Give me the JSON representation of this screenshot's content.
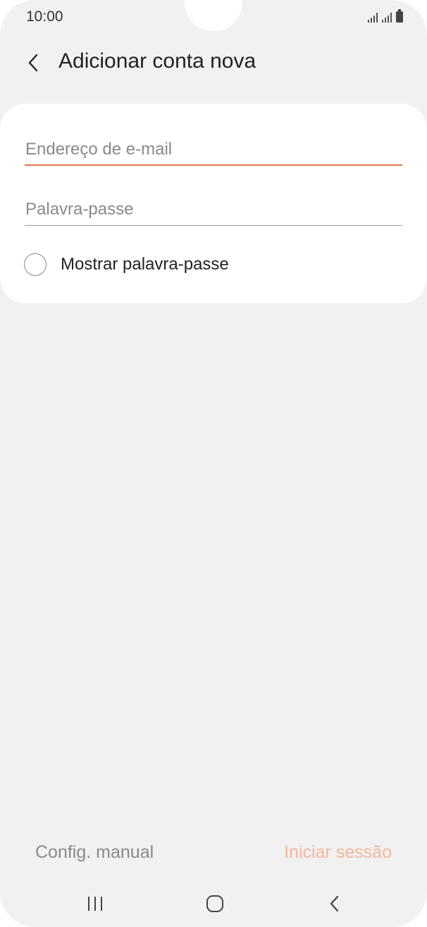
{
  "status_bar": {
    "time": "10:00"
  },
  "header": {
    "title": "Adicionar conta nova",
    "back_icon": "chevron-left-icon"
  },
  "form": {
    "email": {
      "placeholder": "Endereço de e-mail",
      "value": "",
      "focused": true
    },
    "password": {
      "placeholder": "Palavra-passe",
      "value": ""
    },
    "show_password": {
      "label": "Mostrar palavra-passe",
      "checked": false
    }
  },
  "actions": {
    "manual_setup": "Config. manual",
    "sign_in": "Iniciar sessão"
  },
  "navbar": {
    "recent": "recent-apps-icon",
    "home": "home-icon",
    "back": "back-icon"
  },
  "colors": {
    "accent": "#e0763f",
    "accent_disabled": "#f4b79a",
    "background": "#f1f1f1",
    "card": "#ffffff"
  }
}
